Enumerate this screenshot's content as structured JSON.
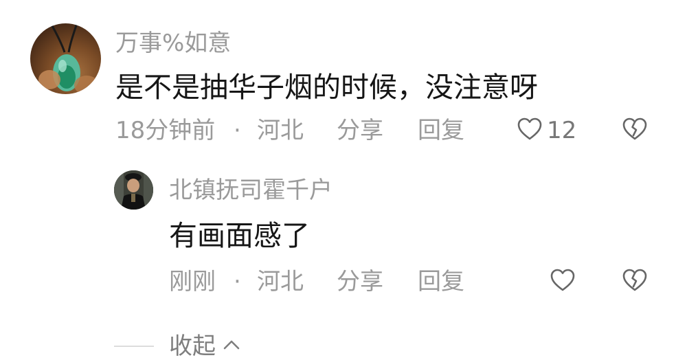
{
  "comment": {
    "username": "万事%如意",
    "text": "是不是抽华子烟的时候，没注意呀",
    "time": "18分钟前",
    "separator": "·",
    "location": "河北",
    "share_label": "分享",
    "reply_label": "回复",
    "like_count": "12",
    "avatar_icon": "jade-pendant-avatar",
    "like_icon": "heart-outline-icon",
    "dislike_icon": "broken-heart-icon"
  },
  "reply": {
    "username": "北镇抚司霍千户",
    "text": "有画面感了",
    "time": "刚刚",
    "separator": "·",
    "location": "河北",
    "share_label": "分享",
    "reply_label": "回复",
    "avatar_icon": "costume-figure-avatar",
    "like_icon": "heart-outline-icon",
    "dislike_icon": "broken-heart-icon"
  },
  "collapse": {
    "label": "收起",
    "icon": "chevron-up-icon"
  },
  "colors": {
    "text_primary": "#161616",
    "text_secondary": "#9a9a9a",
    "background": "#ffffff"
  }
}
